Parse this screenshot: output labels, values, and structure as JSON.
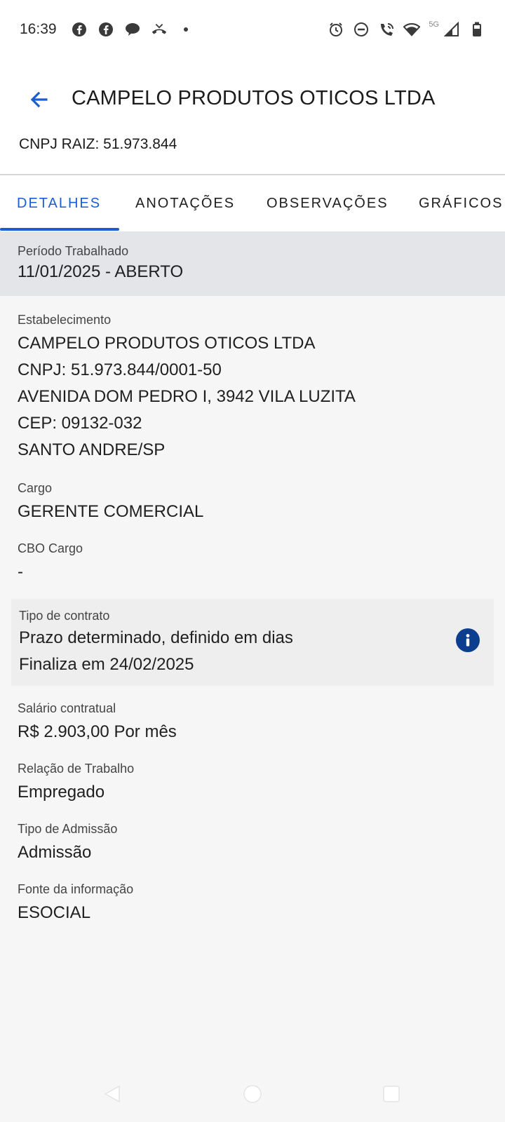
{
  "status_bar": {
    "time": "16:39",
    "left_icons": [
      "facebook-icon",
      "facebook-icon",
      "chat-bubble-icon",
      "missed-call-icon",
      "dot-icon"
    ],
    "right_icons": [
      "alarm-icon",
      "do-not-disturb-icon",
      "wifi-call-icon",
      "wifi-icon",
      "signal-icon",
      "battery-icon"
    ],
    "network": "5G"
  },
  "header": {
    "title": "CAMPELO PRODUTOS OTICOS LTDA",
    "cnpj_raiz": "CNPJ RAIZ: 51.973.844",
    "accent_color": "#1a5fd1"
  },
  "tabs": [
    {
      "label": "DETALHES",
      "active": true
    },
    {
      "label": "ANOTAÇÕES",
      "active": false
    },
    {
      "label": "OBSERVAÇÕES",
      "active": false
    },
    {
      "label": "GRÁFICOS",
      "active": false
    }
  ],
  "period": {
    "label": "Período Trabalhado",
    "value": "11/01/2025 - ABERTO"
  },
  "establishment": {
    "label": "Estabelecimento",
    "name": "CAMPELO PRODUTOS OTICOS LTDA",
    "cnpj": "CNPJ: 51.973.844/0001-50",
    "address": "AVENIDA DOM PEDRO I, 3942 VILA LUZITA",
    "cep": "CEP: 09132-032",
    "city": "SANTO ANDRE/SP"
  },
  "cargo": {
    "label": "Cargo",
    "value": "GERENTE COMERCIAL"
  },
  "cbo": {
    "label": "CBO Cargo",
    "value": "-"
  },
  "contract": {
    "label": "Tipo de contrato",
    "line1": "Prazo determinado, definido em dias",
    "line2": "Finaliza em 24/02/2025",
    "info_color": "#0b3e8f"
  },
  "salary": {
    "label": "Salário contratual",
    "value": "R$ 2.903,00 Por mês"
  },
  "relation": {
    "label": "Relação de Trabalho",
    "value": "Empregado"
  },
  "admission": {
    "label": "Tipo de Admissão",
    "value": "Admissão"
  },
  "source": {
    "label": "Fonte da informação",
    "value": "ESOCIAL"
  }
}
